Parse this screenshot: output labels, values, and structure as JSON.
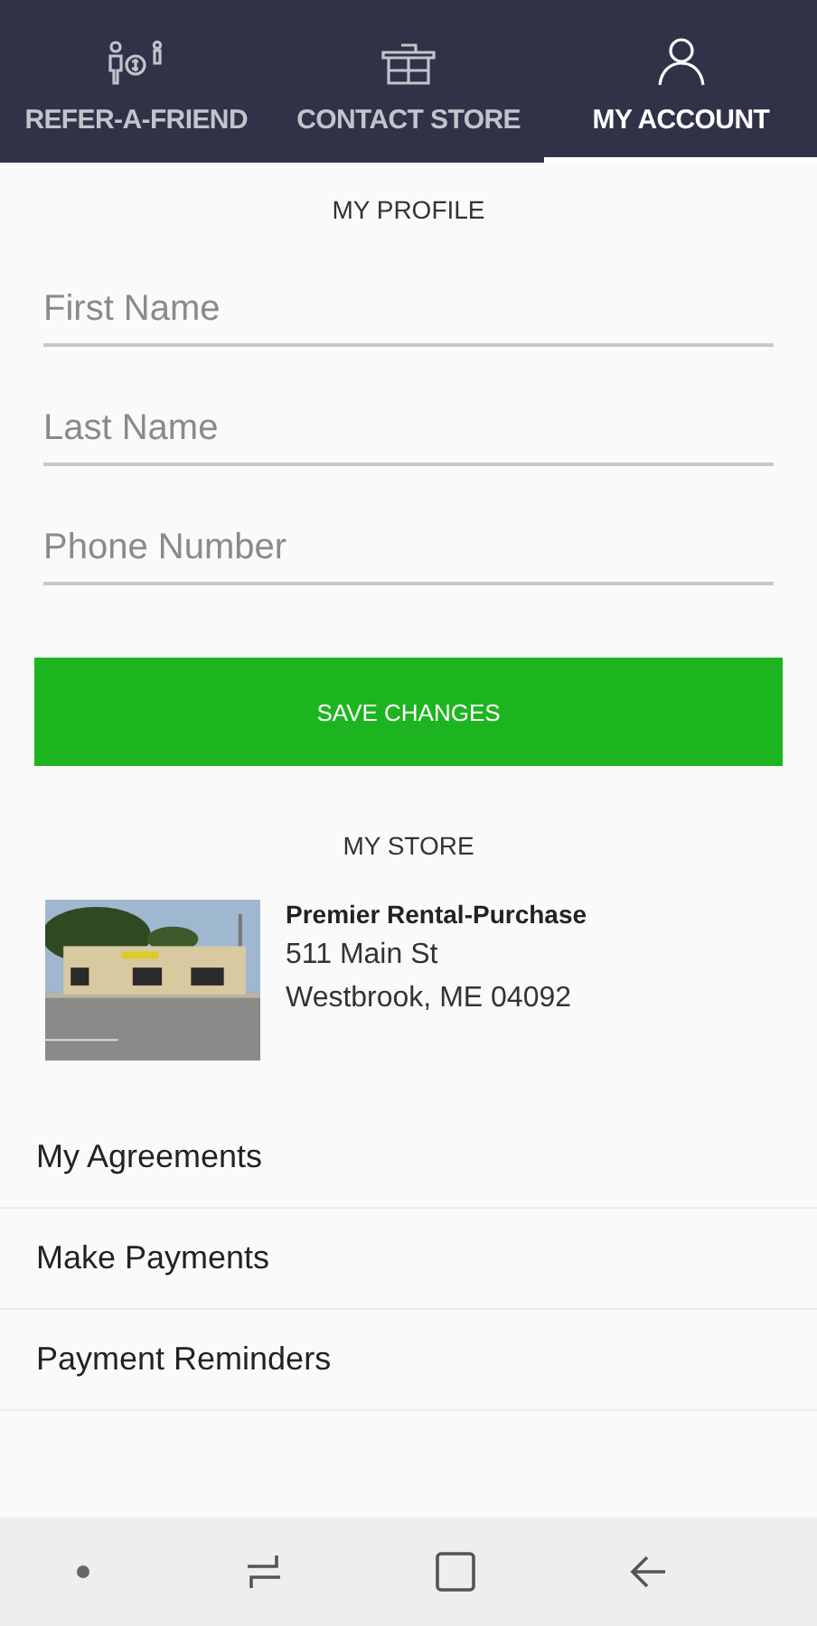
{
  "tabs": [
    {
      "label": "REFER-A-FRIEND",
      "kind": "refer",
      "selected": false
    },
    {
      "label": "CONTACT STORE",
      "kind": "store",
      "selected": false
    },
    {
      "label": "MY ACCOUNT",
      "kind": "account",
      "selected": true
    }
  ],
  "profile": {
    "title": "MY PROFILE",
    "fields": [
      {
        "placeholder": "First Name"
      },
      {
        "placeholder": "Last Name"
      },
      {
        "placeholder": "Phone Number"
      }
    ],
    "save_button": "SAVE CHANGES"
  },
  "store": {
    "title": "MY STORE",
    "name": "Premier Rental-Purchase",
    "address_line_1": "511 Main St",
    "address_line_2": "Westbrook, ME 04092"
  },
  "menu": [
    {
      "label": "My Agreements"
    },
    {
      "label": "Make Payments"
    },
    {
      "label": "Payment Reminders"
    }
  ]
}
